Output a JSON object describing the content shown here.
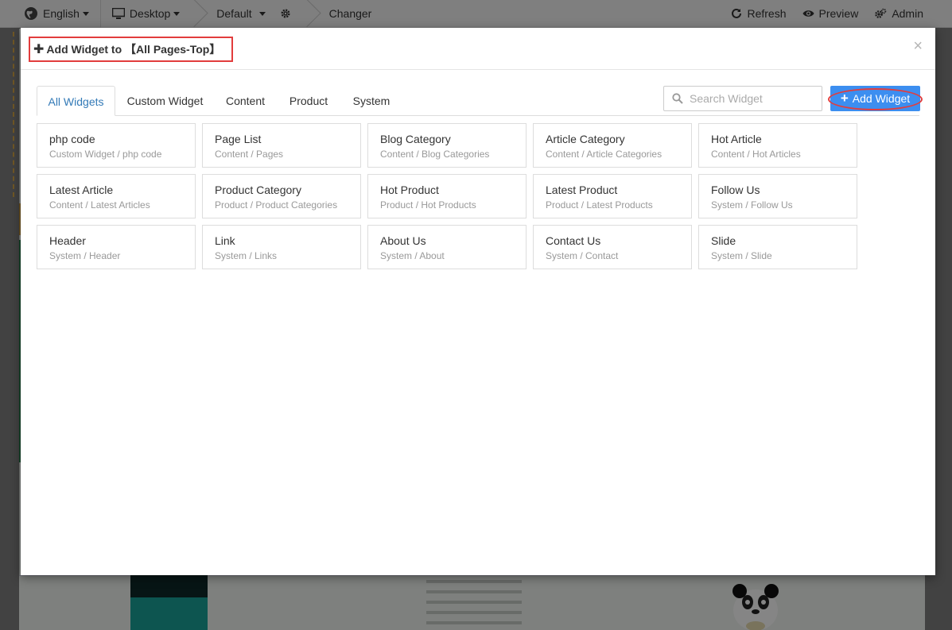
{
  "topbar": {
    "language": "English",
    "device": "Desktop",
    "theme": "Default",
    "changer": "Changer",
    "refresh": "Refresh",
    "preview": "Preview",
    "admin": "Admin"
  },
  "modal": {
    "title": "Add Widget to 【All Pages-Top】",
    "close": "×",
    "search_placeholder": "Search Widget",
    "add_button": "Add Widget",
    "tabs": [
      {
        "label": "All Widgets",
        "active": true
      },
      {
        "label": "Custom Widget",
        "active": false
      },
      {
        "label": "Content",
        "active": false
      },
      {
        "label": "Product",
        "active": false
      },
      {
        "label": "System",
        "active": false
      }
    ],
    "widgets": [
      {
        "title": "php code",
        "path": "Custom Widget / php code"
      },
      {
        "title": "Page List",
        "path": "Content / Pages"
      },
      {
        "title": "Blog Category",
        "path": "Content / Blog Categories"
      },
      {
        "title": "Article Category",
        "path": "Content / Article Categories"
      },
      {
        "title": "Hot Article",
        "path": "Content / Hot Articles"
      },
      {
        "title": "Latest Article",
        "path": "Content / Latest Articles"
      },
      {
        "title": "Product Category",
        "path": "Product / Product Categories"
      },
      {
        "title": "Hot Product",
        "path": "Product / Hot Products"
      },
      {
        "title": "Latest Product",
        "path": "Product / Latest Products"
      },
      {
        "title": "Follow Us",
        "path": "System / Follow Us"
      },
      {
        "title": "Header",
        "path": "System / Header"
      },
      {
        "title": "Link",
        "path": "System / Links"
      },
      {
        "title": "About Us",
        "path": "System / About"
      },
      {
        "title": "Contact Us",
        "path": "System / Contact"
      },
      {
        "title": "Slide",
        "path": "System / Slide"
      }
    ]
  },
  "colors": {
    "accent": "#3c8ef0",
    "highlight": "#e23d3d",
    "active_tab": "#337ab7"
  },
  "icons": {
    "language": "globe-icon",
    "device": "monitor-icon",
    "settings": "gear-icon",
    "refresh": "refresh-icon",
    "preview": "eye-icon",
    "admin": "gears-icon",
    "search": "search-icon",
    "add": "plus-icon",
    "close": "close-icon"
  }
}
